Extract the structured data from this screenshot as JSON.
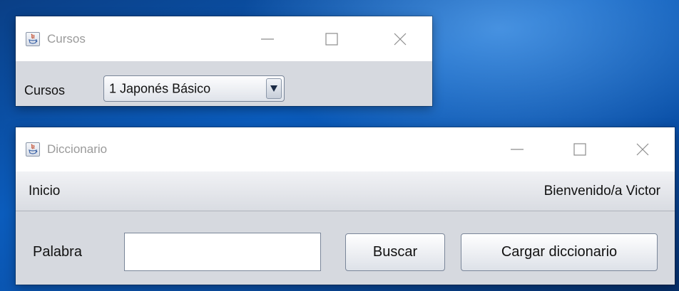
{
  "windows": {
    "cursos": {
      "title": "Cursos",
      "label": "Cursos",
      "combo_value": "1 Japonés Básico"
    },
    "diccionario": {
      "title": "Diccionario",
      "menu_left": "Inicio",
      "menu_right": "Bienvenido/a Victor",
      "palabra_label": "Palabra",
      "palabra_value": "",
      "buscar_label": "Buscar",
      "cargar_label": "Cargar diccionario"
    }
  },
  "icons": {
    "app": "java-app-icon",
    "minimize": "minimize-icon",
    "maximize": "maximize-icon",
    "close": "close-icon",
    "dropdown": "chevron-down-icon"
  },
  "colors": {
    "desktop": "#0b5cbc",
    "window_body": "#d6d9df",
    "titlebar": "#ffffff",
    "title_text": "#9a9a9a"
  }
}
